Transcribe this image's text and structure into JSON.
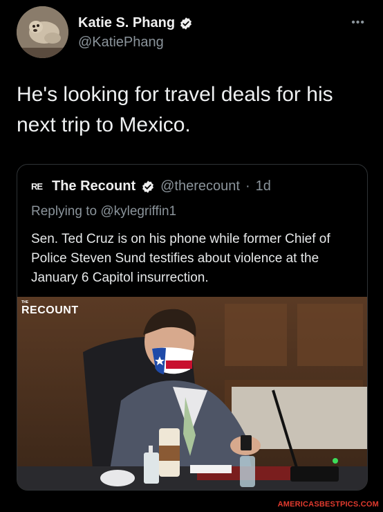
{
  "author": {
    "display_name": "Katie S. Phang",
    "handle": "@KatiePhang",
    "verified": true,
    "avatar_icon": "dog-photo-avatar"
  },
  "more_icon": "more-dots-icon",
  "tweet": {
    "text": "He's looking for travel deals for his next trip to Mexico."
  },
  "quote": {
    "logo_text": "RE",
    "display_name": "The Recount",
    "handle": "@therecount",
    "separator": "·",
    "age": "1d",
    "reply_prefix": "Replying to",
    "reply_mention": "@kylegriffin1",
    "text": "Sen. Ted Cruz is on his phone while former Chief of Police Steven Sund testifies about violence at the January 6 Capitol insurrection.",
    "media": {
      "logo_small": "THE",
      "logo": "RECOUNT",
      "description_icon": "video-still-image"
    }
  },
  "watermark": "AMERICASBESTPICS.COM",
  "colors": {
    "background": "#000000",
    "text": "#e7e9ea",
    "muted": "#8b949b",
    "verified": "#1d9bf0",
    "watermark": "#e23a2e"
  }
}
